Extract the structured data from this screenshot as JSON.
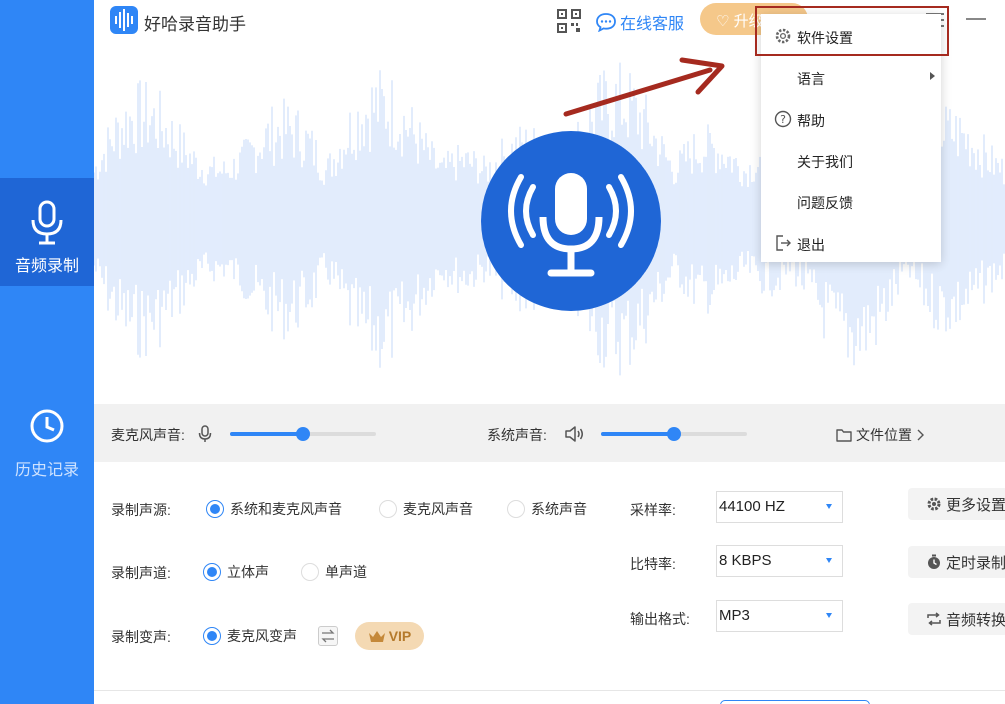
{
  "app": {
    "title": "好哈录音助手"
  },
  "titlebar": {
    "service_label": "在线客服",
    "upgrade_label": "升级"
  },
  "sidebar": {
    "items": [
      {
        "label": "音频录制",
        "active": true,
        "icon": "microphone-icon"
      },
      {
        "label": "历史记录",
        "active": false,
        "icon": "clock-icon"
      }
    ]
  },
  "sliders": {
    "mic_label": "麦克风声音:",
    "mic_level": 0.5,
    "system_label": "系统声音:",
    "system_level": 0.5,
    "file_location_label": "文件位置"
  },
  "settings": {
    "source": {
      "label": "录制声源:",
      "options": [
        "系统和麦克风声音",
        "麦克风声音",
        "系统声音"
      ],
      "selected": "系统和麦克风声音"
    },
    "channel": {
      "label": "录制声道:",
      "options": [
        "立体声",
        "单声道"
      ],
      "selected": "立体声"
    },
    "voice_change": {
      "label": "录制变声:",
      "option": "麦克风变声",
      "vip_label": "VIP"
    },
    "sample_rate": {
      "label": "采样率:",
      "value": "44100 HZ"
    },
    "bit_rate": {
      "label": "比特率:",
      "value": "8 KBPS"
    },
    "output_format": {
      "label": "输出格式:",
      "value": "MP3"
    },
    "side_buttons": [
      "更多设置",
      "定时录制",
      "音频转换"
    ]
  },
  "dropdown": {
    "items": [
      {
        "label": "软件设置",
        "icon": "gear-icon",
        "highlighted": true
      },
      {
        "label": "语言",
        "icon": "",
        "submenu": true
      },
      {
        "label": "帮助",
        "icon": "help-icon"
      },
      {
        "label": "关于我们",
        "icon": ""
      },
      {
        "label": "问题反馈",
        "icon": ""
      },
      {
        "label": "退出",
        "icon": "exit-icon"
      }
    ]
  },
  "colors": {
    "accent": "#2f86f6",
    "accent_dark": "#1f66d6",
    "highlight": "#a52a1f"
  }
}
